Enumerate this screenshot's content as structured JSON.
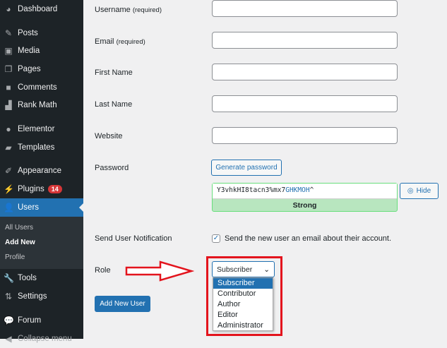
{
  "sidebar": {
    "items": [
      {
        "label": "Dashboard",
        "icon": "dashboard-icon"
      },
      {
        "label": "Posts",
        "icon": "pin-icon"
      },
      {
        "label": "Media",
        "icon": "media-icon"
      },
      {
        "label": "Pages",
        "icon": "pages-icon"
      },
      {
        "label": "Comments",
        "icon": "comment-icon"
      },
      {
        "label": "Rank Math",
        "icon": "chart-icon"
      },
      {
        "label": "Elementor",
        "icon": "elementor-icon"
      },
      {
        "label": "Templates",
        "icon": "folder-icon"
      },
      {
        "label": "Appearance",
        "icon": "brush-icon"
      },
      {
        "label": "Plugins",
        "icon": "plugin-icon",
        "badge": "14"
      },
      {
        "label": "Users",
        "icon": "user-icon"
      },
      {
        "label": "Tools",
        "icon": "wrench-icon"
      },
      {
        "label": "Settings",
        "icon": "settings-icon"
      },
      {
        "label": "Forum",
        "icon": "forum-icon"
      },
      {
        "label": "Collapse menu",
        "icon": "collapse-icon"
      }
    ],
    "submenu": [
      "All Users",
      "Add New",
      "Profile"
    ]
  },
  "form": {
    "username": "Username",
    "username_req": "(required)",
    "email": "Email",
    "email_req": "(required)",
    "first_name": "First Name",
    "last_name": "Last Name",
    "website": "Website",
    "password": "Password",
    "generate": "Generate password",
    "password_value_a": "Y3vhkHI8tacn3%mx7",
    "password_value_b": "GHKMOH",
    "password_value_c": "^",
    "hide": "Hide",
    "strength": "Strong",
    "notification": "Send User Notification",
    "notification_text": "Send the new user an email about their account.",
    "notification_checked": true,
    "role": "Role",
    "role_selected": "Subscriber",
    "role_options": [
      "Subscriber",
      "Contributor",
      "Author",
      "Editor",
      "Administrator"
    ],
    "submit": "Add New User"
  },
  "colors": {
    "accent": "#2271b1",
    "annotation": "#e3141d"
  }
}
